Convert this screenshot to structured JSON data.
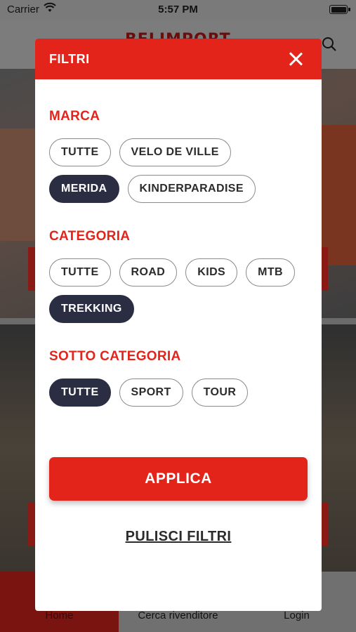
{
  "status_bar": {
    "carrier": "Carrier",
    "time": "5:57 PM"
  },
  "app": {
    "logo": "BELIMPORT",
    "tabs": [
      {
        "label": "Home"
      },
      {
        "label": "Cerca rivenditore"
      },
      {
        "label": "Login"
      }
    ]
  },
  "modal": {
    "title": "FILTRI",
    "sections": [
      {
        "title": "MARCA",
        "options": [
          {
            "label": "TUTTE",
            "selected": false
          },
          {
            "label": "VELO DE VILLE",
            "selected": false
          },
          {
            "label": "MERIDA",
            "selected": true
          },
          {
            "label": "KINDERPARADISE",
            "selected": false
          }
        ]
      },
      {
        "title": "CATEGORIA",
        "options": [
          {
            "label": "TUTTE",
            "selected": false
          },
          {
            "label": "ROAD",
            "selected": false
          },
          {
            "label": "KIDS",
            "selected": false
          },
          {
            "label": "MTB",
            "selected": false
          },
          {
            "label": "TREKKING",
            "selected": true
          }
        ]
      },
      {
        "title": "SOTTO CATEGORIA",
        "options": [
          {
            "label": "TUTTE",
            "selected": true
          },
          {
            "label": "SPORT",
            "selected": false
          },
          {
            "label": "TOUR",
            "selected": false
          }
        ]
      }
    ],
    "apply_label": "APPLICA",
    "clear_label": "PULISCI FILTRI"
  },
  "colors": {
    "accent": "#e3241b",
    "selected_chip": "#2b2d42"
  }
}
